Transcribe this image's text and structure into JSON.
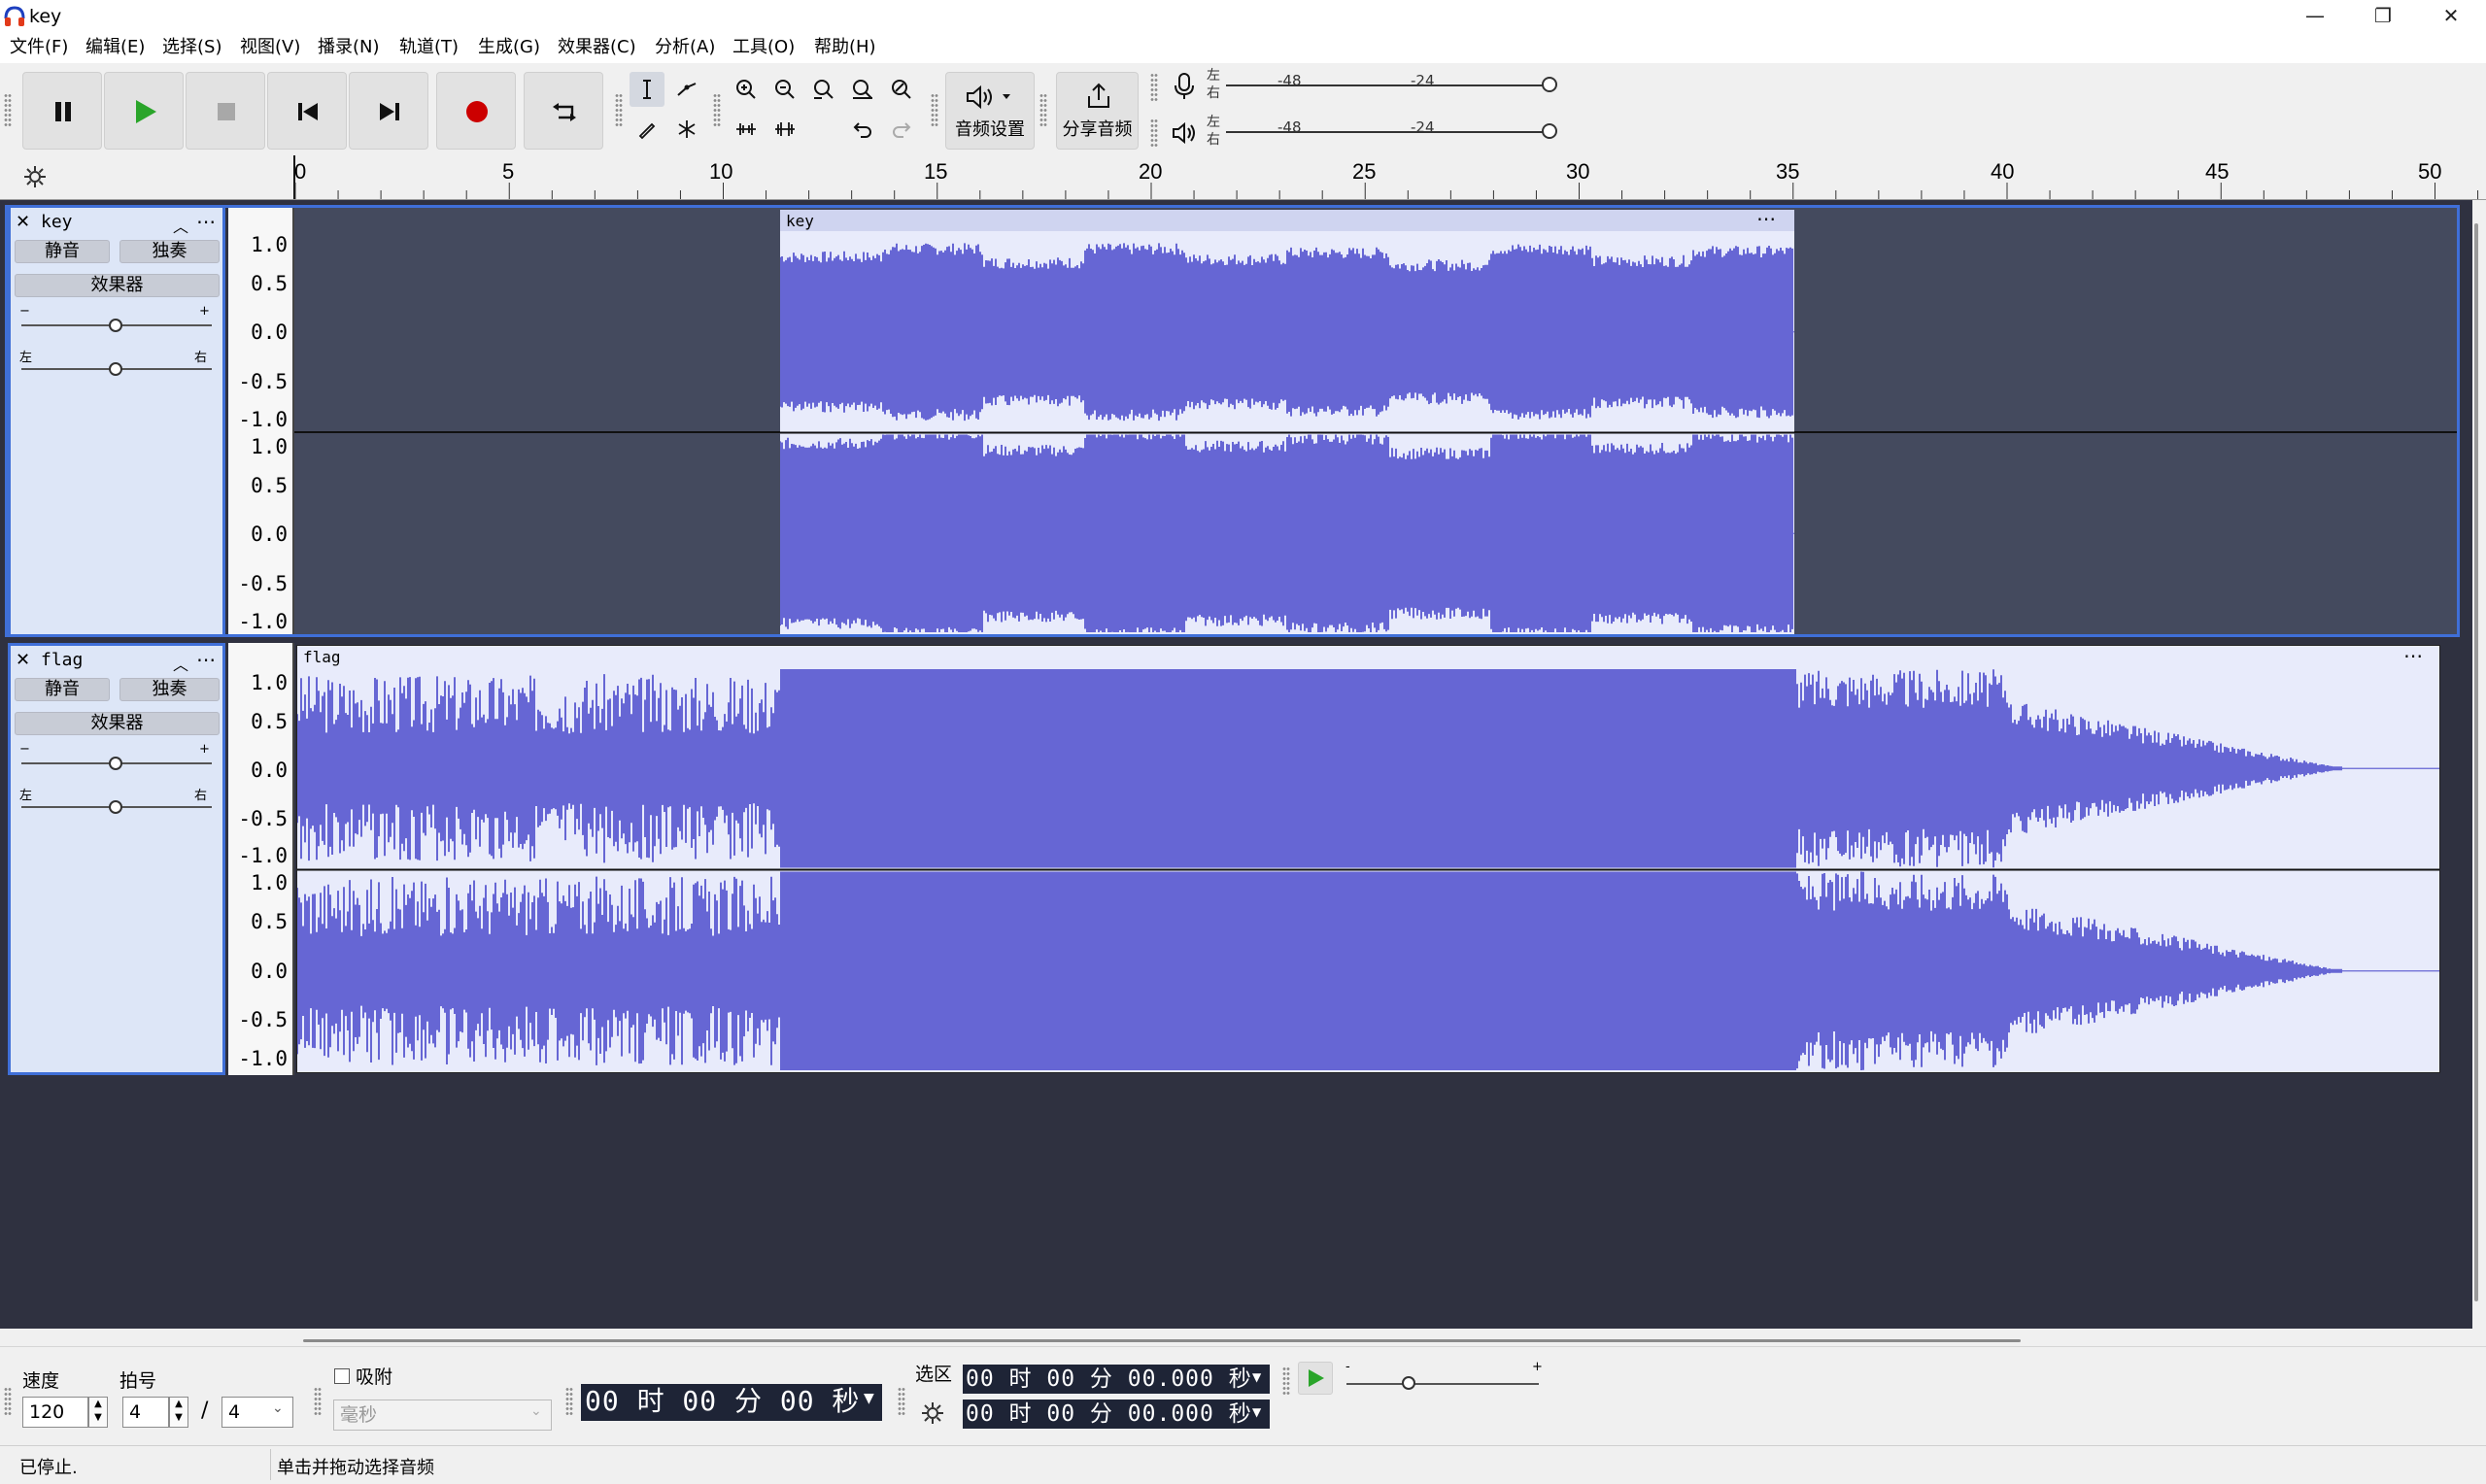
{
  "window": {
    "title": "key",
    "controls": [
      "—",
      "❐",
      "✕"
    ]
  },
  "menu": [
    "文件(F)",
    "编辑(E)",
    "选择(S)",
    "视图(V)",
    "播录(N)",
    "轨道(T)",
    "生成(G)",
    "效果器(C)",
    "分析(A)",
    "工具(O)",
    "帮助(H)"
  ],
  "toolbar": {
    "audio_setup_label": "音频设置",
    "share_label": "分享音频",
    "meter_rec_left": "左",
    "meter_rec_right": "右",
    "meter_play_left": "左",
    "meter_play_right": "右",
    "meter_tick_48": "-48",
    "meter_tick_24": "-24"
  },
  "ruler": {
    "ticks": [
      "0",
      "5",
      "10",
      "15",
      "20",
      "25",
      "30",
      "35",
      "40",
      "45",
      "50"
    ]
  },
  "tracks": [
    {
      "name": "key",
      "mute": "静音",
      "solo": "独奏",
      "effects": "效果器",
      "gain_minus": "−",
      "gain_plus": "+",
      "pan_left": "左",
      "pan_right": "右",
      "clip_title": "key",
      "menu_glyph": "⋯"
    },
    {
      "name": "flag",
      "mute": "静音",
      "solo": "独奏",
      "effects": "效果器",
      "gain_minus": "−",
      "gain_plus": "+",
      "pan_left": "左",
      "pan_right": "右",
      "clip_title": "flag",
      "menu_glyph": "⋯"
    }
  ],
  "vruler_labels": [
    "1.0",
    "0.5",
    "0.0",
    "-0.5",
    "-1.0"
  ],
  "bottom": {
    "tempo_label": "速度",
    "tempo_value": "120",
    "timesig_label": "拍号",
    "timesig_num": "4",
    "timesig_sep": "/",
    "timesig_den": "4",
    "snap_label": "吸附",
    "snap_unit": "毫秒",
    "time_display": "00 时 00 分 00 秒",
    "selection_label": "选区",
    "sel_start": "00 时 00 分 00.000 秒",
    "sel_end": "00 时 00 分 00.000 秒",
    "speed_minus": "-",
    "speed_plus": "+"
  },
  "status": {
    "state": "已停止.",
    "hint": "单击并拖动选择音频"
  },
  "colors": {
    "waveform": "#6666d4",
    "clip_bg": "#e8ebfb",
    "track_area_bg": "#2f3140",
    "record": "#cc0000",
    "play": "#2aa52a"
  }
}
